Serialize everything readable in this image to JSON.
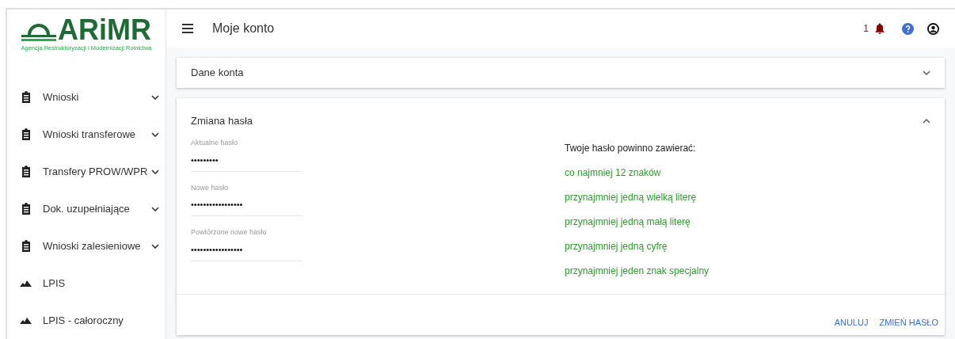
{
  "logo": {
    "title": "ARiMR",
    "subtitle": "Agencja Restrukturyzacji i Modernizacji Rolnictwa"
  },
  "sidebar": {
    "items": [
      {
        "label": "Wnioski",
        "kind": "clipboard",
        "expandable": true
      },
      {
        "label": "Wnioski transferowe",
        "kind": "clipboard",
        "expandable": true
      },
      {
        "label": "Transfery PROW/WPR",
        "kind": "clipboard",
        "expandable": true
      },
      {
        "label": "Dok. uzupełniające",
        "kind": "clipboard",
        "expandable": true
      },
      {
        "label": "Wnioski zalesieniowe",
        "kind": "clipboard",
        "expandable": true
      },
      {
        "label": "LPIS",
        "kind": "terrain",
        "expandable": false
      },
      {
        "label": "LPIS - całoroczny",
        "kind": "terrain",
        "expandable": false
      }
    ]
  },
  "header": {
    "title": "Moje konto",
    "notification_count": "1"
  },
  "panels": [
    {
      "title": "Dane konta",
      "expanded": false
    },
    {
      "title": "Zmiana hasła",
      "expanded": true
    }
  ],
  "password_form": {
    "fields": [
      {
        "label": "Aktualne hasło",
        "value": "•••••••••"
      },
      {
        "label": "Nowe hasło",
        "value": "•••••••••••••••••"
      },
      {
        "label": "Powtórzone nowe hasło",
        "value": "•••••••••••••••••"
      }
    ],
    "requirements_title": "Twoje hasło powinno zawierać:",
    "requirements": [
      {
        "text": "co najmniej 12 znaków",
        "met": true
      },
      {
        "text": "przynajmniej jedną wielką literę",
        "met": true
      },
      {
        "text": "przynajmniej jedną małą literę",
        "met": true
      },
      {
        "text": "przynajmniej jedną cyfrę",
        "met": true
      },
      {
        "text": "przynajmniej jeden znak specjalny",
        "met": true
      }
    ],
    "buttons": [
      "ANULUJ",
      "ZMIEŃ HASŁO"
    ]
  }
}
